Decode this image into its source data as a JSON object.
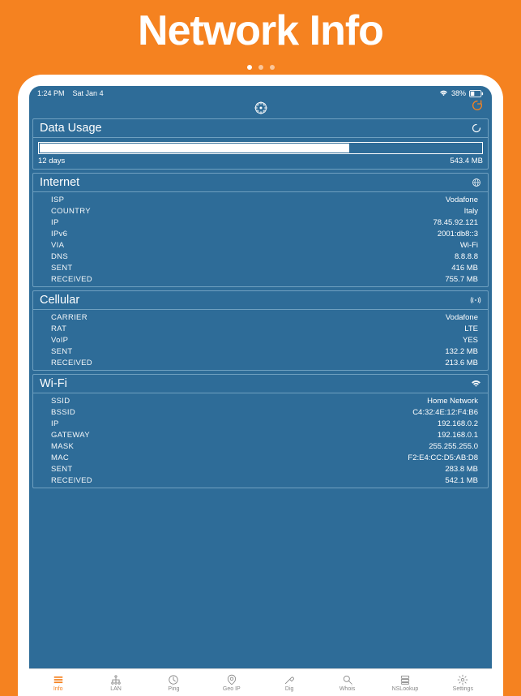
{
  "marketing": {
    "title": "Network Info"
  },
  "statusBar": {
    "time": "1:24 PM",
    "date": "Sat Jan 4",
    "battery": "38%"
  },
  "dataUsage": {
    "title": "Data Usage",
    "period": "12 days",
    "total": "543.4 MB",
    "progressPercent": 70
  },
  "internet": {
    "title": "Internet",
    "rows": [
      {
        "k": "ISP",
        "v": "Vodafone"
      },
      {
        "k": "COUNTRY",
        "v": "Italy"
      },
      {
        "k": "IP",
        "v": "78.45.92.121"
      },
      {
        "k": "IPv6",
        "v": "2001:db8::3"
      },
      {
        "k": "VIA",
        "v": "Wi-Fi"
      },
      {
        "k": "DNS",
        "v": "8.8.8.8"
      },
      {
        "k": "SENT",
        "v": "416 MB"
      },
      {
        "k": "RECEIVED",
        "v": "755.7 MB"
      }
    ]
  },
  "cellular": {
    "title": "Cellular",
    "rows": [
      {
        "k": "CARRIER",
        "v": "Vodafone"
      },
      {
        "k": "RAT",
        "v": "LTE"
      },
      {
        "k": "VoIP",
        "v": "YES"
      },
      {
        "k": "SENT",
        "v": "132.2 MB"
      },
      {
        "k": "RECEIVED",
        "v": "213.6 MB"
      }
    ]
  },
  "wifi": {
    "title": "Wi-Fi",
    "rows": [
      {
        "k": "SSID",
        "v": "Home Network"
      },
      {
        "k": "BSSID",
        "v": "C4:32:4E:12:F4:B6"
      },
      {
        "k": "IP",
        "v": "192.168.0.2"
      },
      {
        "k": "GATEWAY",
        "v": "192.168.0.1"
      },
      {
        "k": "MASK",
        "v": "255.255.255.0"
      },
      {
        "k": "MAC",
        "v": "F2:E4:CC:D5:AB:D8"
      },
      {
        "k": "SENT",
        "v": "283.8 MB"
      },
      {
        "k": "RECEIVED",
        "v": "542.1 MB"
      }
    ]
  },
  "tabs": [
    {
      "label": "Info",
      "active": true
    },
    {
      "label": "LAN",
      "active": false
    },
    {
      "label": "Ping",
      "active": false
    },
    {
      "label": "Geo IP",
      "active": false
    },
    {
      "label": "Dig",
      "active": false
    },
    {
      "label": "Whois",
      "active": false
    },
    {
      "label": "NSLookup",
      "active": false
    },
    {
      "label": "Settings",
      "active": false
    }
  ]
}
